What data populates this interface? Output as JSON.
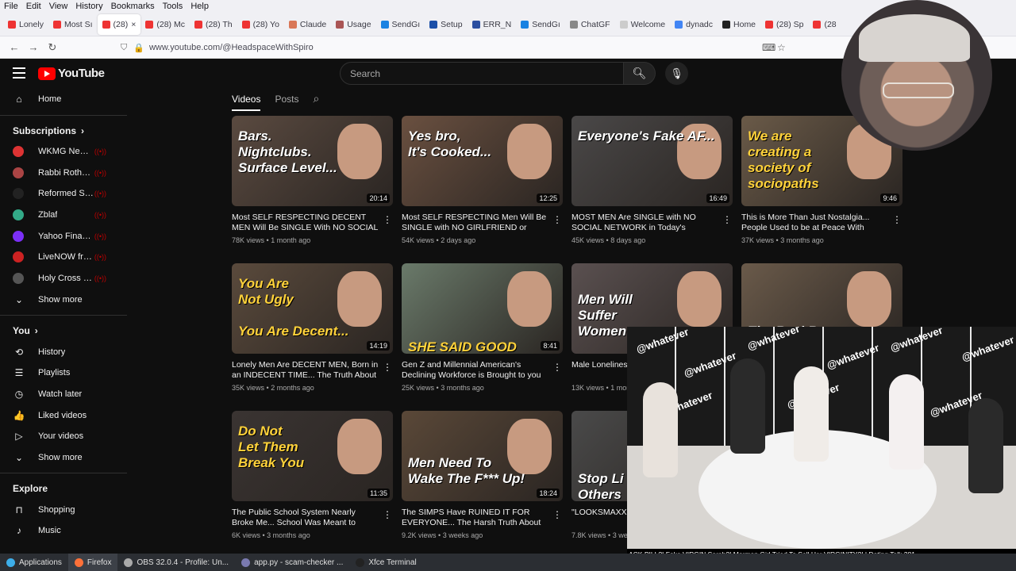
{
  "menubar": [
    "File",
    "Edit",
    "View",
    "History",
    "Bookmarks",
    "Tools",
    "Help"
  ],
  "tabs": [
    {
      "label": "Lonely",
      "color": "#e33"
    },
    {
      "label": "Most Sı",
      "color": "#e33"
    },
    {
      "label": "(28)",
      "color": "#e33",
      "active": true
    },
    {
      "label": "(28) Mc",
      "color": "#e33"
    },
    {
      "label": "(28) Th",
      "color": "#e33"
    },
    {
      "label": "(28) Yo",
      "color": "#e33"
    },
    {
      "label": "Claude",
      "color": "#d97757"
    },
    {
      "label": "Usage",
      "color": "#a55"
    },
    {
      "label": "SendGı",
      "color": "#1a82e2"
    },
    {
      "label": "Setup",
      "color": "#1b4fa8"
    },
    {
      "label": "ERR_N",
      "color": "#2b4ea0"
    },
    {
      "label": "SendGı",
      "color": "#1a82e2"
    },
    {
      "label": "ChatGF",
      "color": "#888"
    },
    {
      "label": "Welcome",
      "color": "#ccc"
    },
    {
      "label": "dynadc",
      "color": "#4285f4"
    },
    {
      "label": "Home",
      "color": "#222"
    },
    {
      "label": "(28) Sp",
      "color": "#e33"
    },
    {
      "label": "(28",
      "color": "#e33"
    }
  ],
  "url": "www.youtube.com/@HeadspaceWithSpiro",
  "yt": {
    "logo": "YouTube",
    "search_placeholder": "Search",
    "sidebar": {
      "home": "Home",
      "subs_header": "Subscriptions",
      "subs": [
        {
          "name": "WKMG News 6 C...",
          "color": "#d33"
        },
        {
          "name": "Rabbi Rothschild",
          "color": "#a44"
        },
        {
          "name": "Reformed Stoic",
          "color": "#222"
        },
        {
          "name": "Zblaf",
          "color": "#3a8"
        },
        {
          "name": "Yahoo Finance",
          "color": "#7b2ff7"
        },
        {
          "name": "LiveNOW from F...",
          "color": "#c22"
        },
        {
          "name": "Holy Cross Mona...",
          "color": "#555"
        }
      ],
      "show_more_1": "Show more",
      "you_header": "You",
      "you_items": [
        {
          "label": "History",
          "icon": "history-icon",
          "glyph": "⟲"
        },
        {
          "label": "Playlists",
          "icon": "playlists-icon",
          "glyph": "☰"
        },
        {
          "label": "Watch later",
          "icon": "clock-icon",
          "glyph": "◷"
        },
        {
          "label": "Liked videos",
          "icon": "thumbs-up-icon",
          "glyph": "👍"
        },
        {
          "label": "Your videos",
          "icon": "video-icon",
          "glyph": "▷"
        }
      ],
      "show_more_2": "Show more",
      "explore_header": "Explore",
      "explore_items": [
        {
          "label": "Shopping",
          "icon": "shopping-bag-icon",
          "glyph": "⊓"
        },
        {
          "label": "Music",
          "icon": "music-icon",
          "glyph": "♪"
        }
      ]
    },
    "channel_tabs": {
      "videos": "Videos",
      "posts": "Posts"
    },
    "videos": [
      {
        "overlay": "Bars.\nNightclubs.\nSurface Level...",
        "ov_color": "#fff",
        "bg": "#5a4a40",
        "dur": "20:14",
        "title": "Most SELF RESPECTING DECENT MEN Will Be SINGLE With NO SOCIAL LIFE in Today's...",
        "views": "78K views",
        "age": "1 month ago"
      },
      {
        "overlay": "Yes bro,\nIt's Cooked...",
        "ov_color": "#fff",
        "bg": "#6a5040",
        "dur": "12:25",
        "title": "Most SELF RESPECTING Men Will Be SINGLE with NO GIRLFRIEND or FRIEND...",
        "views": "54K views",
        "age": "2 days ago"
      },
      {
        "overlay": "Everyone's Fake AF...",
        "ov_color": "#fff",
        "bg": "#4a4848",
        "dur": "16:49",
        "title": "MOST MEN Are SINGLE with NO SOCIAL NETWORK in Today's Climate... And I Know...",
        "views": "45K views",
        "age": "8 days ago"
      },
      {
        "overlay": "We are\ncreating a\nsociety of\nsociopaths",
        "ov_color": "#ffd23a",
        "bg": "#6a5a48",
        "dur": "9:46",
        "title": "This is More Than Just Nostalgia... People Used to be at Peace With Themselves,...",
        "views": "37K views",
        "age": "3 months ago"
      },
      {
        "overlay": "You Are\nNot Ugly\n\nYou Are Decent...",
        "ov_color": "#ffd23a",
        "bg": "#5a4a3c",
        "dur": "14:19",
        "title": "Lonely Men Are DECENT MEN, Born in an INDECENT TIME... The Truth About Male...",
        "views": "35K views",
        "age": "2 months ago"
      },
      {
        "overlay": "\n\n\n\nSHE SAID GOOD MORNING",
        "ov_color": "#ffd23a",
        "bg": "#6a7a6a",
        "dur": "8:41",
        "title": "Gen Z and Millennial American's Declining Workforce is Brought to you By a Decline in...",
        "views": "25K views",
        "age": "3 months ago"
      },
      {
        "overlay": "\nMen Will\nSuffer\nWomen",
        "ov_color": "#fff",
        "bg": "#5a5050",
        "dur": "",
        "title": "Male Loneliness... be the Brunt, Wo...",
        "views": "13K views",
        "age": "1 month ago"
      },
      {
        "overlay": "\n\n\nThe Real Reason",
        "ov_color": "#fff",
        "bg": "#6a5a4a",
        "dur": "",
        "title": "",
        "views": "",
        "age": ""
      },
      {
        "overlay": "Do Not\nLet Them\nBreak You",
        "ov_color": "#ffd23a",
        "bg": "#3a3432",
        "dur": "11:35",
        "title": "The Public School System Nearly Broke Me... School Was Meant to Shape Minds, Not...",
        "views": "6K views",
        "age": "3 months ago"
      },
      {
        "overlay": "\n\nMen Need To\nWake The F*** Up!",
        "ov_color": "#fff",
        "bg": "#5a4838",
        "dur": "18:24",
        "title": "The SIMPS Have RUINED IT FOR EVERYONE... The Harsh Truth About Femal...",
        "views": "9.2K views",
        "age": "3 weeks ago"
      },
      {
        "overlay": "\n\n\nStop Li\nOthers",
        "ov_color": "#fff",
        "bg": "#4a4a4a",
        "dur": "",
        "title": "\"LOOKSMAXXIN... Female Attention...",
        "views": "7.8K views",
        "age": "3 week"
      }
    ]
  },
  "pip": {
    "watermark": "@whatever",
    "caption": "ACK PILL?! Fake VIRGIN Sarah?! Mormon Girl Tried To Sell Her VIRGINITY?! | Dating Talk 281"
  },
  "taskbar": [
    {
      "label": "Applications",
      "color": "#3daee9"
    },
    {
      "label": "Firefox",
      "color": "#ff7139"
    },
    {
      "label": "OBS 32.0.4 - Profile: Un...",
      "color": "#aaa"
    },
    {
      "label": "app.py - scam-checker ...",
      "color": "#7a7ab0"
    },
    {
      "label": "Xfce Terminal",
      "color": "#222"
    }
  ]
}
